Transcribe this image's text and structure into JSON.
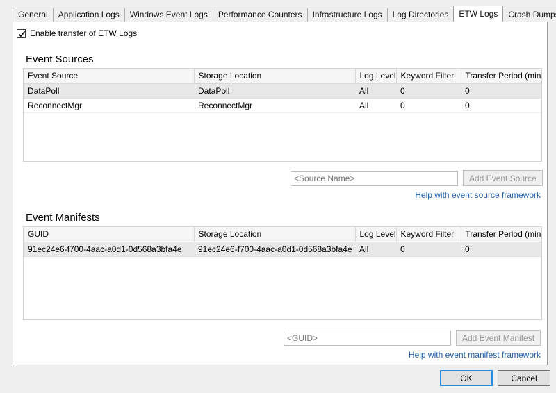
{
  "tabs": [
    {
      "label": "General",
      "selected": false
    },
    {
      "label": "Application Logs",
      "selected": false
    },
    {
      "label": "Windows Event Logs",
      "selected": false
    },
    {
      "label": "Performance Counters",
      "selected": false
    },
    {
      "label": "Infrastructure Logs",
      "selected": false
    },
    {
      "label": "Log Directories",
      "selected": false
    },
    {
      "label": "ETW Logs",
      "selected": true
    },
    {
      "label": "Crash Dumps",
      "selected": false
    }
  ],
  "enable_checkbox": {
    "label": "Enable transfer of ETW Logs",
    "checked": true,
    "icon": "check-icon"
  },
  "event_sources": {
    "title": "Event Sources",
    "columns": [
      "Event Source",
      "Storage Location",
      "Log Level",
      "Keyword Filter",
      "Transfer Period (min)"
    ],
    "rows": [
      {
        "selected": true,
        "cells": [
          "DataPoll",
          "DataPoll",
          "All",
          "0",
          "0"
        ]
      },
      {
        "selected": false,
        "cells": [
          "ReconnectMgr",
          "ReconnectMgr",
          "All",
          "0",
          "0"
        ]
      }
    ],
    "input_placeholder": "<Source Name>",
    "input_value": "",
    "add_button": "Add Event Source",
    "add_button_enabled": false,
    "help_link": "Help with event source framework"
  },
  "event_manifests": {
    "title": "Event Manifests",
    "columns": [
      "GUID",
      "Storage Location",
      "Log Level",
      "Keyword Filter",
      "Transfer Period (min)"
    ],
    "rows": [
      {
        "selected": true,
        "cells": [
          "91ec24e6-f700-4aac-a0d1-0d568a3bfa4e",
          "91ec24e6-f700-4aac-a0d1-0d568a3bfa4e",
          "All",
          "0",
          "0"
        ]
      }
    ],
    "input_placeholder": "<GUID>",
    "input_value": "",
    "add_button": "Add Event Manifest",
    "add_button_enabled": false,
    "help_link": "Help with event manifest framework"
  },
  "footer": {
    "ok_label": "OK",
    "cancel_label": "Cancel",
    "default_button": "OK"
  },
  "colors": {
    "link": "#1d5fa8",
    "focus_border": "#2a8ae0",
    "window_background": "#efefef",
    "panel_background": "#ffffff",
    "header_background": "#f5f5f5",
    "selected_row": "#e8e8e8",
    "disabled_text": "#9a9a9a"
  }
}
